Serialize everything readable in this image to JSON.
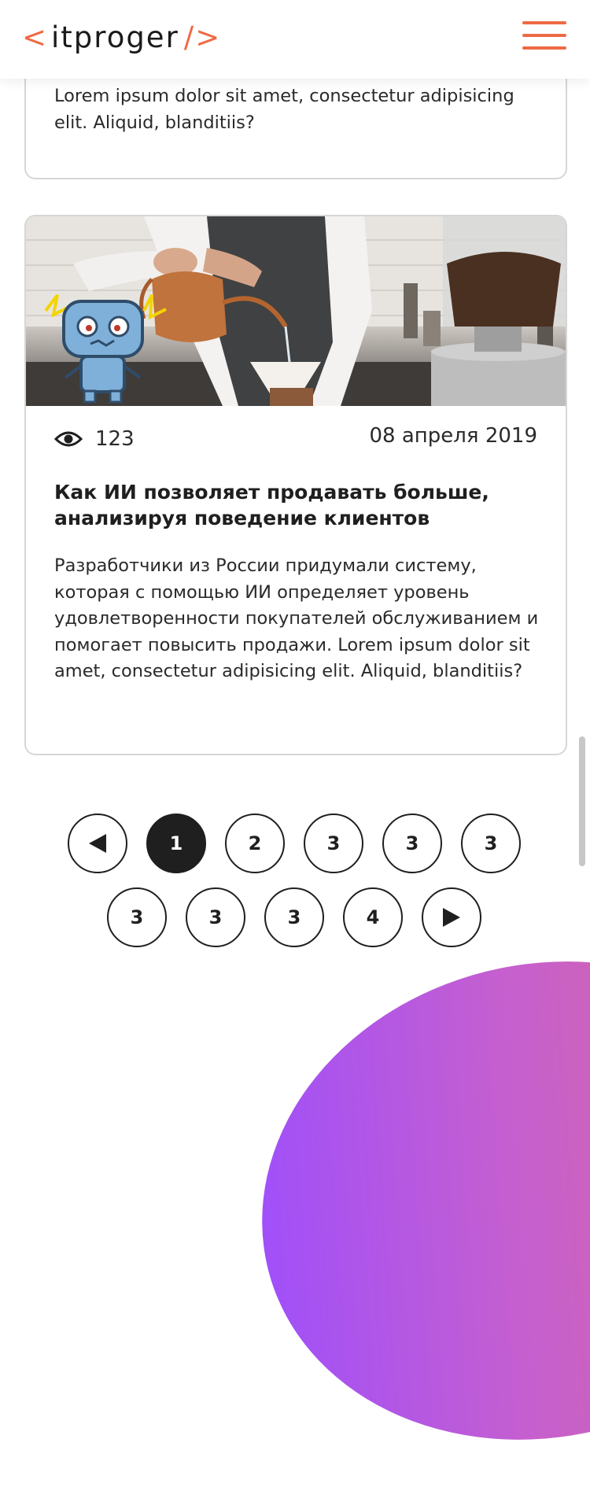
{
  "header": {
    "logo_left_bracket": "<",
    "logo_text": "itproger",
    "logo_right_bracket": "/>"
  },
  "colors": {
    "accent": "#ee6a44",
    "text": "#1f1f1f",
    "gradient": [
      "#9b4dff",
      "#dd6c8e"
    ]
  },
  "previous_card": {
    "excerpt_tail": "Lorem ipsum dolor sit amet, consectetur adipisicing elit. Aliquid, blanditiis?"
  },
  "article": {
    "image_icon": "photo-barista-with-robot-sticker",
    "views_icon": "eye-icon",
    "views": "123",
    "date": "08 апреля 2019",
    "title": "Как ИИ позволяет продавать больше, анализируя поведение клиентов",
    "excerpt": "Разработчики из России придумали систему, которая с помощью ИИ определяет уровень удовлетворенности покупателей обслуживанием и помогает повысить продажи. Lorem ipsum dolor sit amet, consectetur adipisicing elit. Aliquid, blanditiis?"
  },
  "pagination": {
    "prev_icon": "triangle-left-icon",
    "next_icon": "triangle-right-icon",
    "pages": [
      "1",
      "2",
      "3",
      "3",
      "3",
      "3",
      "3",
      "3",
      "4"
    ],
    "current": "1"
  }
}
